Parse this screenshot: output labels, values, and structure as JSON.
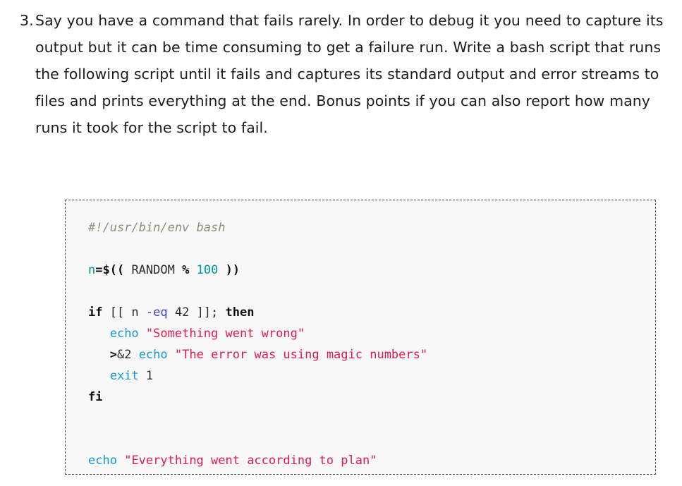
{
  "colors": {
    "page_background": "#ffffff",
    "code_background": "#f8f8f8",
    "code_border": "#4a4a4a",
    "text": "#1c1c1c",
    "comment": "#8f8f7a",
    "variable": "#008f8f",
    "number": "#009999",
    "operator": "#111111",
    "keyword": "#111111",
    "builtin": "#1297d1",
    "flag": "#4040c0",
    "string": "#e01b4c"
  },
  "exercise": {
    "marker": "3.",
    "paragraph": "Say you have a command that fails rarely. In order to debug it you need to capture its output but it can be time consuming to get a failure run. Write a bash script that runs the following script until it fails and captures its standard output and error streams to files and prints everything at the end. Bonus points if you can also report how many runs it took for the script to fail."
  },
  "code_block": {
    "language": "bash",
    "lines": [
      {
        "id": "line-1",
        "tokens": [
          {
            "t": "comment",
            "s": "#!/usr/bin/env bash"
          }
        ]
      },
      {
        "id": "line-2",
        "tokens": []
      },
      {
        "id": "line-3",
        "tokens": [
          {
            "t": "var",
            "s": "n"
          },
          {
            "t": "op",
            "s": "=$(("
          },
          {
            "t": "plain",
            "s": " RANDOM "
          },
          {
            "t": "op",
            "s": "%"
          },
          {
            "t": "plain",
            "s": " "
          },
          {
            "t": "num",
            "s": "100"
          },
          {
            "t": "plain",
            "s": " "
          },
          {
            "t": "op",
            "s": "))"
          }
        ]
      },
      {
        "id": "line-4",
        "tokens": []
      },
      {
        "id": "line-5",
        "tokens": [
          {
            "t": "kw",
            "s": "if"
          },
          {
            "t": "plain",
            "s": " [[ n "
          },
          {
            "t": "flag",
            "s": "-eq"
          },
          {
            "t": "plain",
            "s": " 42 ]]; "
          },
          {
            "t": "kw",
            "s": "then"
          }
        ]
      },
      {
        "id": "line-6",
        "tokens": [
          {
            "t": "plain",
            "s": "   "
          },
          {
            "t": "builtin",
            "s": "echo"
          },
          {
            "t": "plain",
            "s": " "
          },
          {
            "t": "string",
            "s": "\"Something went wrong\""
          }
        ]
      },
      {
        "id": "line-7",
        "tokens": [
          {
            "t": "plain",
            "s": "   "
          },
          {
            "t": "redir",
            "s": ">"
          },
          {
            "t": "plain",
            "s": "&2 "
          },
          {
            "t": "builtin",
            "s": "echo"
          },
          {
            "t": "plain",
            "s": " "
          },
          {
            "t": "string",
            "s": "\"The error was using magic numbers\""
          }
        ]
      },
      {
        "id": "line-8",
        "tokens": [
          {
            "t": "plain",
            "s": "   "
          },
          {
            "t": "builtin",
            "s": "exit"
          },
          {
            "t": "plain",
            "s": " 1"
          }
        ]
      },
      {
        "id": "line-9",
        "tokens": [
          {
            "t": "kw",
            "s": "fi"
          }
        ]
      },
      {
        "id": "line-10",
        "tokens": []
      },
      {
        "id": "line-11",
        "tokens": []
      },
      {
        "id": "line-12",
        "tokens": [
          {
            "t": "builtin",
            "s": "echo"
          },
          {
            "t": "plain",
            "s": " "
          },
          {
            "t": "string",
            "s": "\"Everything went according to plan\""
          }
        ]
      }
    ]
  }
}
